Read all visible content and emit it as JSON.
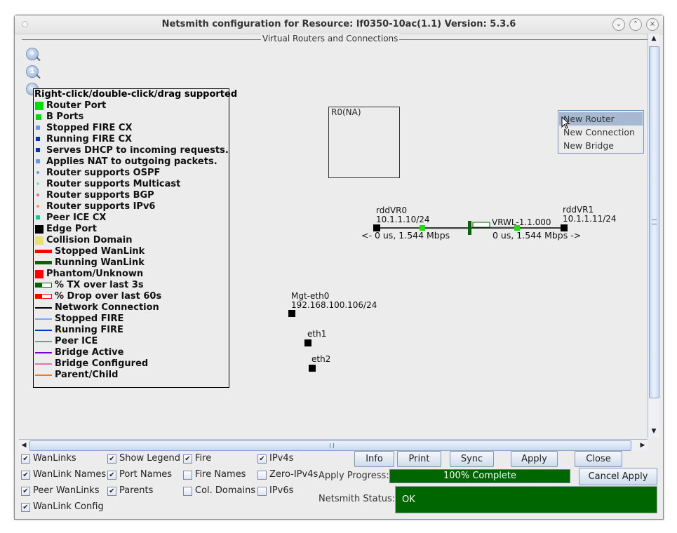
{
  "window": {
    "title": "Netsmith configuration for Resource:  lf0350-10ac(1.1)  Version: 5.3.6",
    "controls": [
      "minimize",
      "maximize",
      "close"
    ]
  },
  "canvas": {
    "panel_title": "Virtual Routers and Connections",
    "zoom_tools": [
      {
        "name": "zoom-in-icon",
        "glyph": "+"
      },
      {
        "name": "zoom-reset-icon",
        "glyph": "1"
      },
      {
        "name": "zoom-out-icon",
        "glyph": "−"
      }
    ],
    "legend": {
      "header": "Right-click/double-click/drag supported",
      "items": [
        {
          "label": "Router Port",
          "swatch": "square-large",
          "color": "#00dd00"
        },
        {
          "label": "B Ports",
          "swatch": "square-medium",
          "color": "#00dd00"
        },
        {
          "label": "Stopped FIRE CX",
          "swatch": "square-small",
          "color": "#6699ee"
        },
        {
          "label": "Running FIRE CX",
          "swatch": "square-small",
          "color": "#0033cc"
        },
        {
          "label": "Serves DHCP to incoming requests.",
          "swatch": "square-small",
          "color": "#0033cc"
        },
        {
          "label": "Applies NAT to outgoing packets.",
          "swatch": "square-small",
          "color": "#6699ee"
        },
        {
          "label": "Router supports OSPF",
          "swatch": "dot",
          "color": "#6699ee"
        },
        {
          "label": "Router supports Multicast",
          "swatch": "dot",
          "color": "#77ee99"
        },
        {
          "label": "Router supports BGP",
          "swatch": "dot",
          "color": "#ee6699"
        },
        {
          "label": "Router supports IPv6",
          "swatch": "dot",
          "color": "#ee9966"
        },
        {
          "label": "Peer ICE CX",
          "swatch": "square-small",
          "color": "#11cc99"
        },
        {
          "label": "Edge Port",
          "swatch": "square-large",
          "color": "#000000"
        },
        {
          "label": "Collision Domain",
          "swatch": "square-large",
          "color": "#e6e07a"
        },
        {
          "label": "Stopped WanLink",
          "swatch": "bar",
          "color": "#ff0000"
        },
        {
          "label": "Running WanLink",
          "swatch": "bar",
          "color": "#006600"
        },
        {
          "label": "Phantom/Unknown",
          "swatch": "square-large",
          "color": "#ff0000"
        },
        {
          "label": "% TX over last 3s",
          "swatch": "progress",
          "color": "#006600"
        },
        {
          "label": "% Drop over last 60s",
          "swatch": "progress",
          "color": "#ff0000"
        },
        {
          "label": "Network Connection",
          "swatch": "line",
          "color": "#000000"
        },
        {
          "label": "Stopped FIRE",
          "swatch": "line",
          "color": "#77aaff"
        },
        {
          "label": "Running FIRE",
          "swatch": "line",
          "color": "#0033cc"
        },
        {
          "label": "Peer ICE",
          "swatch": "line",
          "color": "#11cc99"
        },
        {
          "label": "Bridge Active",
          "swatch": "line",
          "color": "#7700dd"
        },
        {
          "label": "Bridge Configured",
          "swatch": "line",
          "color": "#dd77aa"
        },
        {
          "label": "Parent/Child",
          "swatch": "line",
          "color": "#ff7711"
        }
      ]
    },
    "router": {
      "label": "R0(NA)"
    },
    "ports": {
      "rddVR0": {
        "name": "rddVR0",
        "ip": "10.1.1.10/24",
        "stats": "<- 0 us, 1.544 Mbps"
      },
      "rddVR1": {
        "name": "rddVR1",
        "ip": "10.1.1.11/24",
        "stats": "0 us, 1.544 Mbps ->"
      },
      "wanlink": {
        "name": "VRWL-1.1.000"
      },
      "mgt": {
        "name": "Mgt-eth0",
        "ip": "192.168.100.106/24"
      },
      "eth1": {
        "name": "eth1"
      },
      "eth2": {
        "name": "eth2"
      }
    },
    "context_menu": {
      "items": [
        "New Router",
        "New Connection",
        "New Bridge"
      ],
      "selected": "New Router"
    }
  },
  "options": {
    "col1": [
      {
        "label": "WanLinks",
        "checked": true
      },
      {
        "label": "WanLink Names",
        "checked": true
      },
      {
        "label": "Peer WanLinks",
        "checked": true
      },
      {
        "label": "WanLink Config",
        "checked": true
      }
    ],
    "col2": [
      {
        "label": "Show Legend",
        "checked": true
      },
      {
        "label": "Port Names",
        "checked": true
      },
      {
        "label": "Parents",
        "checked": true
      }
    ],
    "col3": [
      {
        "label": "Fire",
        "checked": true
      },
      {
        "label": "Fire Names",
        "checked": false
      },
      {
        "label": "Col. Domains",
        "checked": false
      }
    ],
    "col4": [
      {
        "label": "IPv4s",
        "checked": true
      },
      {
        "label": "Zero-IPv4s",
        "checked": false
      },
      {
        "label": "IPv6s",
        "checked": false
      }
    ]
  },
  "buttons": {
    "info": "Info",
    "print": "Print",
    "sync": "Sync",
    "apply": "Apply",
    "close": "Close",
    "cancel_apply": "Cancel Apply"
  },
  "apply_progress": {
    "label": "Apply Progress:",
    "percent": 100,
    "text": "100% Complete",
    "color": "#006600"
  },
  "netsmith_status": {
    "label": "Netsmith Status:",
    "text": "OK",
    "color": "#006600"
  }
}
